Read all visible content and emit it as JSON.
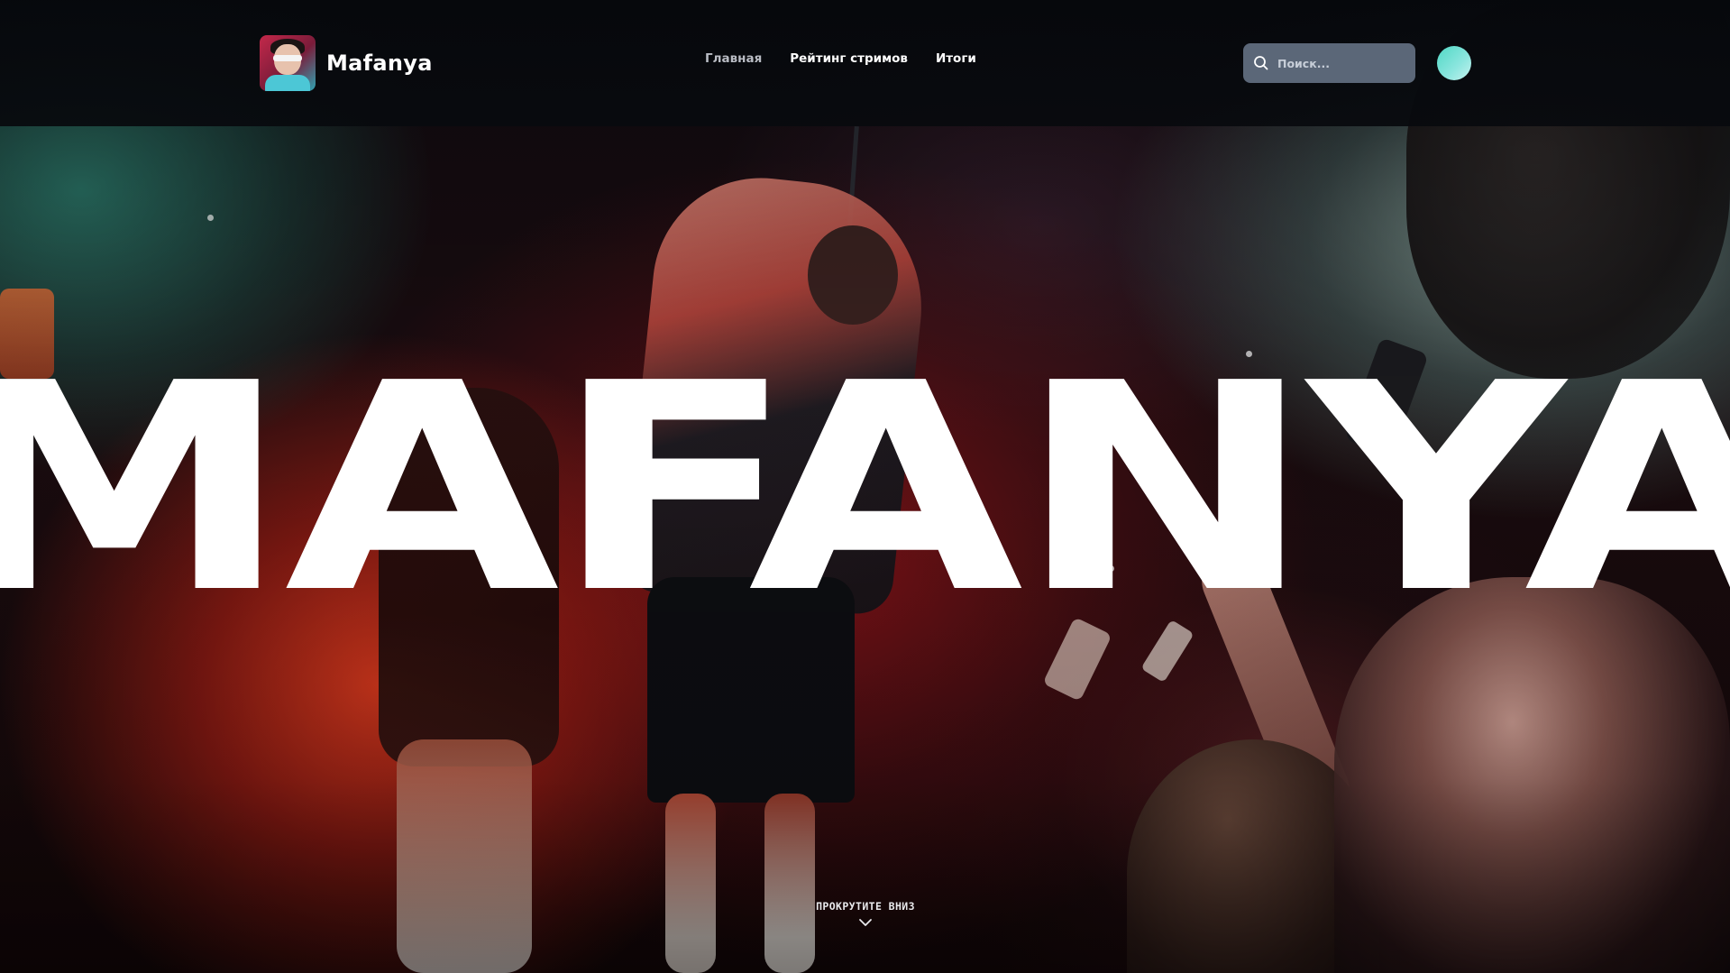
{
  "brand": {
    "name": "Mafanya"
  },
  "nav": {
    "items": [
      {
        "label": "Главная",
        "active": true
      },
      {
        "label": "Рейтинг стримов",
        "active": false
      },
      {
        "label": "Итоги",
        "active": false
      }
    ]
  },
  "search": {
    "placeholder": "Поиск...",
    "value": ""
  },
  "hero": {
    "title": "MAFANYA",
    "scroll_hint": "ПРОКРУТИТЕ ВНИЗ"
  },
  "colors": {
    "navbar_bg": "#06080c",
    "search_bg": "#5b6778",
    "avatar_accent": "#4fd8c4",
    "active_nav": "#b9bcc4",
    "text_primary": "#ffffff"
  },
  "icons": {
    "logo": "artist-avatar-logo",
    "search": "search-icon",
    "profile": "profile-avatar",
    "scroll": "chevron-down-icon"
  }
}
